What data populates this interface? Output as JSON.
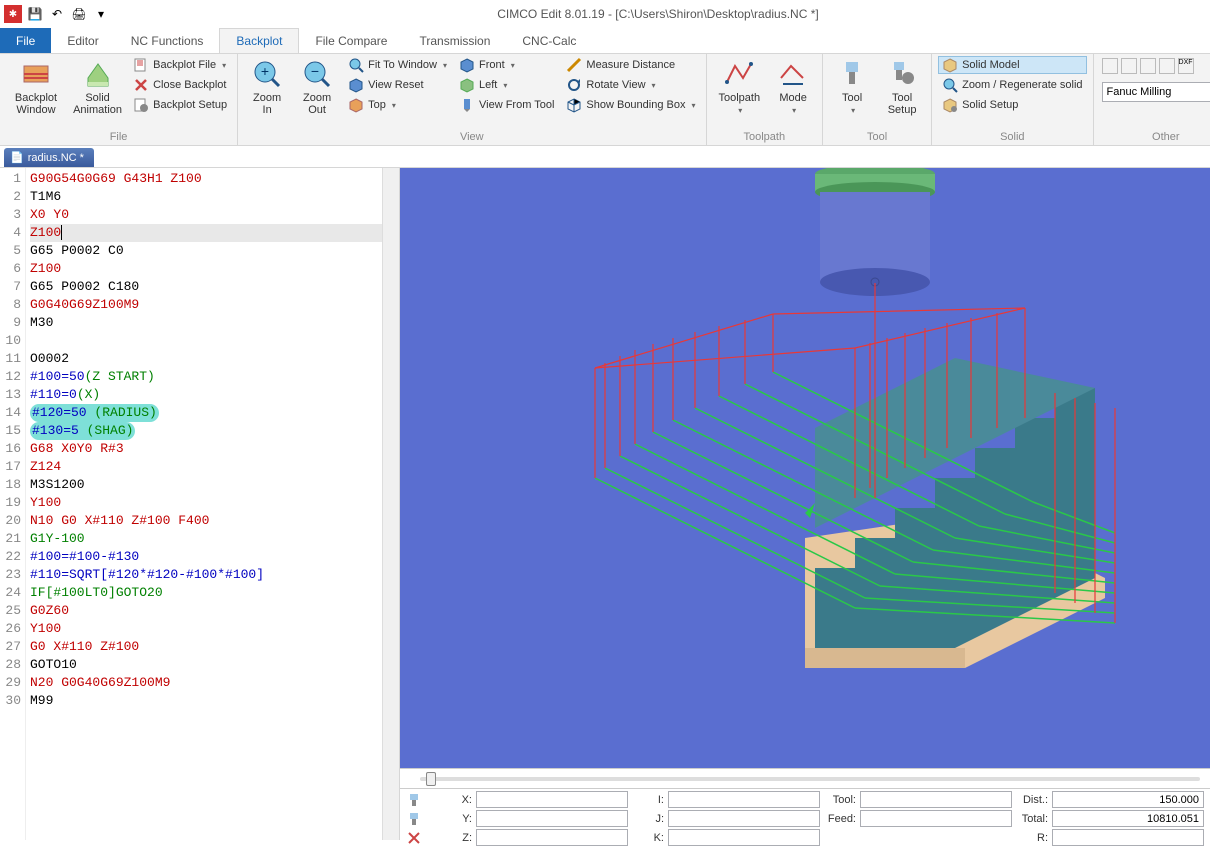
{
  "title": "CIMCO Edit 8.01.19 - [C:\\Users\\Shiron\\Desktop\\radius.NC *]",
  "qa": {
    "save": "💾",
    "undo": "↶",
    "print": "🖨"
  },
  "tabs": {
    "file": "File",
    "editor": "Editor",
    "nc": "NC Functions",
    "backplot": "Backplot",
    "filecompare": "File Compare",
    "transmission": "Transmission",
    "cnccalc": "CNC-Calc"
  },
  "ribbon": {
    "file_group": {
      "backplot_window": "Backplot\nWindow",
      "solid_animation": "Solid\nAnimation",
      "backplot_file": "Backplot File",
      "close_backplot": "Close Backplot",
      "backplot_setup": "Backplot Setup",
      "label": "File"
    },
    "view_group": {
      "zoom_in": "Zoom\nIn",
      "zoom_out": "Zoom\nOut",
      "fit": "Fit To Window",
      "view_reset": "View Reset",
      "top": "Top",
      "front": "Front",
      "left": "Left",
      "view_from_tool": "View From Tool",
      "measure": "Measure Distance",
      "rotate": "Rotate View",
      "bounding": "Show Bounding Box",
      "label": "View"
    },
    "toolpath_group": {
      "toolpath": "Toolpath",
      "mode": "Mode",
      "label": "Toolpath"
    },
    "tool_group": {
      "tool": "Tool",
      "tool_setup": "Tool\nSetup",
      "label": "Tool"
    },
    "solid_group": {
      "solid_model": "Solid Model",
      "zoom_regen": "Zoom / Regenerate solid",
      "solid_setup": "Solid Setup",
      "label": "Solid"
    },
    "other_group": {
      "label": "Other",
      "input": "Fanuc Milling"
    }
  },
  "doc_tab": "radius.NC *",
  "code_lines": [
    {
      "n": 1,
      "t": [
        [
          "G90G54G0G69 G43H1 Z100",
          "red"
        ]
      ]
    },
    {
      "n": 2,
      "t": [
        [
          "T1M6",
          "black"
        ]
      ]
    },
    {
      "n": 3,
      "t": [
        [
          "X0 Y0",
          "red"
        ]
      ]
    },
    {
      "n": 4,
      "t": [
        [
          "Z100",
          "red"
        ]
      ],
      "cursor": true
    },
    {
      "n": 5,
      "t": [
        [
          "G65 P0002 C0",
          "black"
        ]
      ]
    },
    {
      "n": 6,
      "t": [
        [
          "Z100",
          "red"
        ]
      ]
    },
    {
      "n": 7,
      "t": [
        [
          "G65 P0002 C180",
          "black"
        ]
      ]
    },
    {
      "n": 8,
      "t": [
        [
          "G0G40G69Z100M9",
          "red"
        ]
      ]
    },
    {
      "n": 9,
      "t": [
        [
          "M30",
          "black"
        ]
      ]
    },
    {
      "n": 10,
      "t": [
        [
          "",
          ""
        ]
      ]
    },
    {
      "n": 11,
      "t": [
        [
          "O0002",
          "black"
        ]
      ]
    },
    {
      "n": 12,
      "t": [
        [
          "#100=50",
          "blue"
        ],
        [
          "(Z START)",
          "green"
        ]
      ]
    },
    {
      "n": 13,
      "t": [
        [
          "#110=0",
          "blue"
        ],
        [
          "(X)",
          "green"
        ]
      ]
    },
    {
      "n": 14,
      "t": [
        [
          "#120=50 ",
          "blue"
        ],
        [
          "(RADIUS)",
          "green"
        ]
      ],
      "hl": true
    },
    {
      "n": 15,
      "t": [
        [
          "#130=5 ",
          "blue"
        ],
        [
          "(SHAG)",
          "green"
        ]
      ],
      "hl": true
    },
    {
      "n": 16,
      "t": [
        [
          "G68 X0Y0 R#3",
          "red"
        ]
      ]
    },
    {
      "n": 17,
      "t": [
        [
          "Z124",
          "red"
        ]
      ]
    },
    {
      "n": 18,
      "t": [
        [
          "M3S1200",
          "black"
        ]
      ]
    },
    {
      "n": 19,
      "t": [
        [
          "Y100",
          "red"
        ]
      ]
    },
    {
      "n": 20,
      "t": [
        [
          "N10 G0 X#110 Z#100 F400",
          "red"
        ]
      ]
    },
    {
      "n": 21,
      "t": [
        [
          "G1Y-100",
          "green"
        ]
      ]
    },
    {
      "n": 22,
      "t": [
        [
          "#100=#100-#130",
          "blue"
        ]
      ]
    },
    {
      "n": 23,
      "t": [
        [
          "#110=SQRT[#120*#120-#100*#100]",
          "blue"
        ]
      ]
    },
    {
      "n": 24,
      "t": [
        [
          "IF[#100LT0]GOTO20",
          "green"
        ]
      ]
    },
    {
      "n": 25,
      "t": [
        [
          "G0Z60",
          "red"
        ]
      ]
    },
    {
      "n": 26,
      "t": [
        [
          "Y100",
          "red"
        ]
      ]
    },
    {
      "n": 27,
      "t": [
        [
          "G0 X#110 Z#100",
          "red"
        ]
      ]
    },
    {
      "n": 28,
      "t": [
        [
          "GOTO10",
          "black"
        ]
      ]
    },
    {
      "n": 29,
      "t": [
        [
          "N20 G0G40G69Z100M9",
          "red"
        ]
      ]
    },
    {
      "n": 30,
      "t": [
        [
          "M99",
          "black"
        ]
      ]
    }
  ],
  "status": {
    "x_lbl": "X:",
    "x_val": "",
    "y_lbl": "Y:",
    "y_val": "",
    "z_lbl": "Z:",
    "z_val": "",
    "i_lbl": "I:",
    "i_val": "",
    "j_lbl": "J:",
    "j_val": "",
    "k_lbl": "K:",
    "k_val": "",
    "tool_lbl": "Tool:",
    "tool_val": "",
    "feed_lbl": "Feed:",
    "feed_val": "",
    "dist_lbl": "Dist.:",
    "dist_val": "150.000",
    "total_lbl": "Total:",
    "total_val": "10810.051",
    "r_lbl": "R:",
    "r_val": ""
  }
}
